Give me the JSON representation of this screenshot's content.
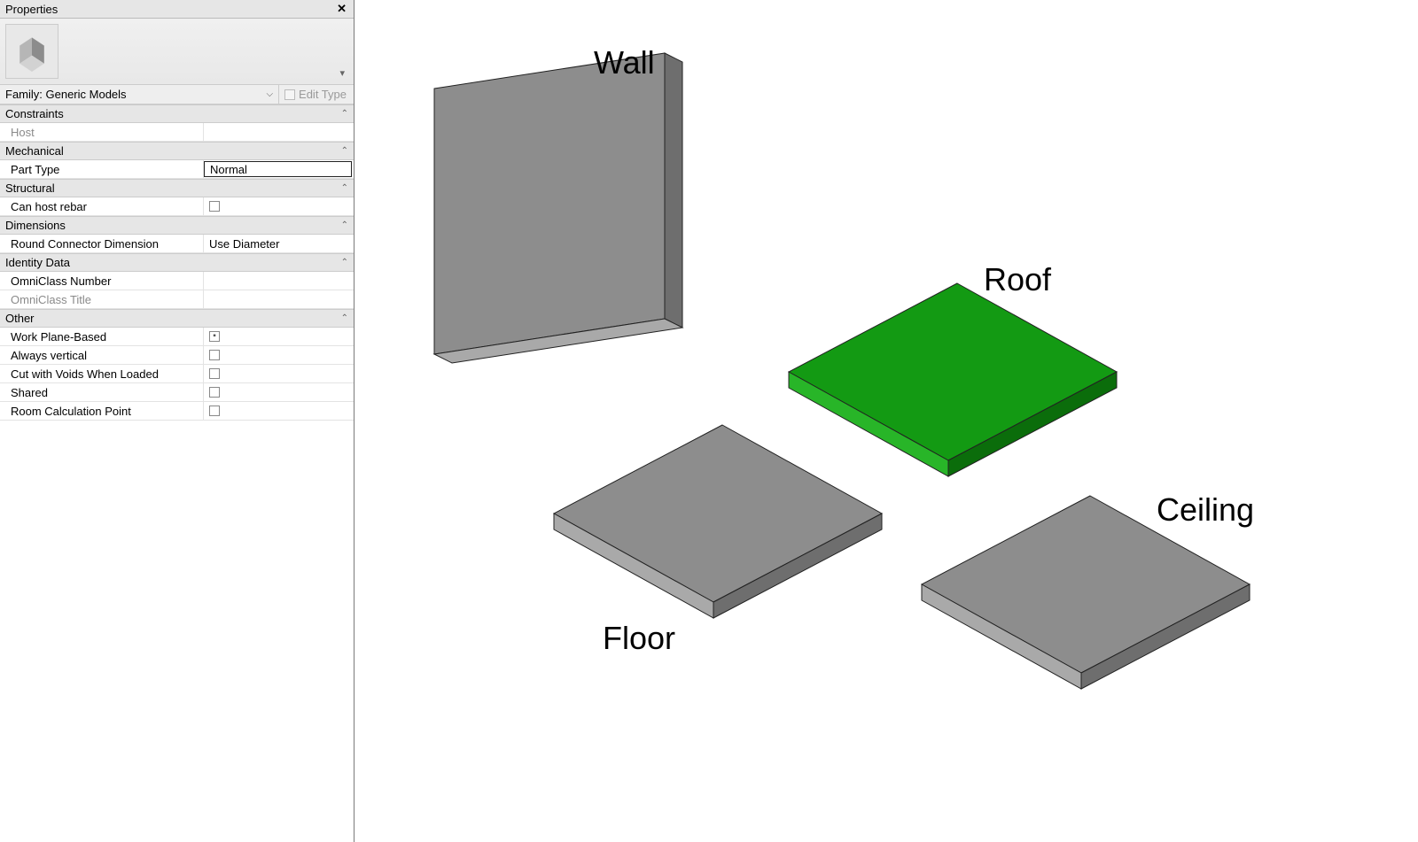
{
  "panel": {
    "title": "Properties",
    "close_glyph": "✕",
    "family_label": "Family: Generic Models",
    "edit_type_label": "Edit Type"
  },
  "groups": {
    "constraints": {
      "title": "Constraints",
      "host_label": "Host",
      "host_value": ""
    },
    "mechanical": {
      "title": "Mechanical",
      "part_type_label": "Part Type",
      "part_type_value": "Normal"
    },
    "structural": {
      "title": "Structural",
      "can_host_rebar_label": "Can host rebar",
      "can_host_rebar_checked": false
    },
    "dimensions": {
      "title": "Dimensions",
      "rcd_label": "Round Connector Dimension",
      "rcd_value": "Use Diameter"
    },
    "identity": {
      "title": "Identity Data",
      "omni_num_label": "OmniClass Number",
      "omni_num_value": "",
      "omni_title_label": "OmniClass Title",
      "omni_title_value": ""
    },
    "other": {
      "title": "Other",
      "wpb_label": "Work Plane-Based",
      "wpb_checked": true,
      "av_label": "Always vertical",
      "av_checked": false,
      "cvw_label": "Cut with Voids When Loaded",
      "cvw_checked": false,
      "shared_label": "Shared",
      "shared_checked": false,
      "rcp_label": "Room Calculation Point",
      "rcp_checked": false
    }
  },
  "viewport": {
    "labels": {
      "wall": "Wall",
      "roof": "Roof",
      "floor": "Floor",
      "ceiling": "Ceiling"
    },
    "colors": {
      "gray_top": "#8d8d8d",
      "gray_side_light": "#a9a9a9",
      "gray_side_dark": "#6e6e6e",
      "green_top": "#139a13",
      "green_side_light": "#28b528",
      "green_side_dark": "#0b6d0b",
      "edge": "#222"
    }
  }
}
